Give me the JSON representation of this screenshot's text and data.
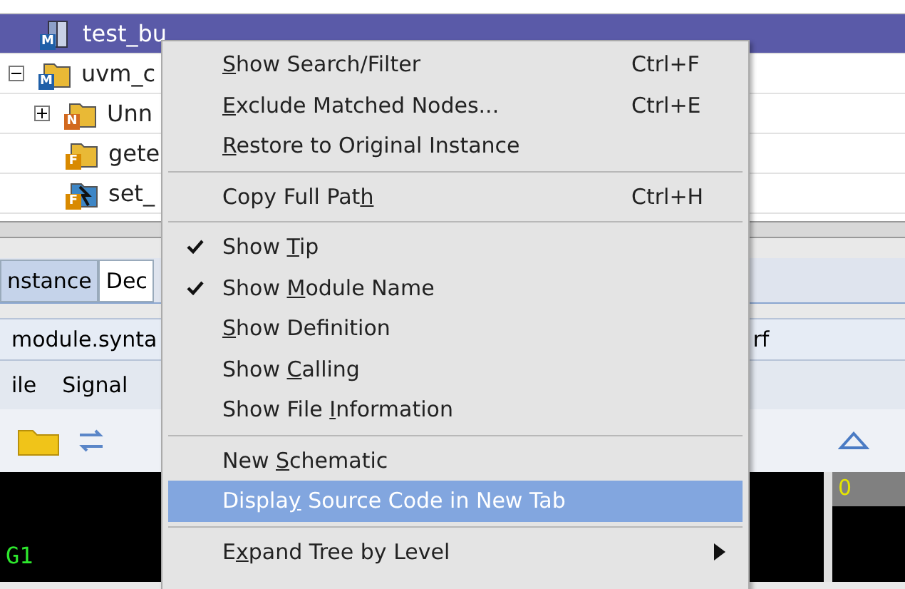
{
  "tree": [
    {
      "label": "test_bu",
      "badge": "M",
      "kind": "module",
      "selected": true
    },
    {
      "label": "uvm_c",
      "badge": "M",
      "kind": "folder",
      "selected": false,
      "expanded": true,
      "children": [
        {
          "label": "Unn",
          "badge": "N",
          "kind": "folder",
          "selected": false,
          "expanded": false
        },
        {
          "label": "gete",
          "badge": "F",
          "kind": "folder",
          "selected": false
        },
        {
          "label": "set_",
          "badge": "F",
          "kind": "function",
          "selected": false
        }
      ]
    }
  ],
  "tabs": [
    {
      "label": "nstance",
      "selected": true
    },
    {
      "label": "Dec",
      "selected": false
    }
  ],
  "path_bar": {
    "left": "module.synta",
    "right": "rf"
  },
  "menubar": [
    "ile",
    "Signal"
  ],
  "waveform": {
    "signal": "G1",
    "ruler": "0"
  },
  "context_menu": [
    [
      {
        "key": "S",
        "after": "how Search/Filter",
        "shortcut": "Ctrl+F",
        "checked": false,
        "selected": false
      },
      {
        "key": "E",
        "after": "xclude Matched Nodes...",
        "shortcut": "Ctrl+E",
        "checked": false,
        "selected": false
      },
      {
        "key": "R",
        "after": "estore to Original Instance",
        "checked": false,
        "selected": false
      }
    ],
    [
      {
        "before": "Copy Full Pat",
        "key": "h",
        "shortcut": "Ctrl+H",
        "checked": false,
        "selected": false
      }
    ],
    [
      {
        "before": "Show ",
        "key": "T",
        "after": "ip",
        "checked": true,
        "selected": false
      },
      {
        "before": "Show ",
        "key": "M",
        "after": "odule Name",
        "checked": true,
        "selected": false
      },
      {
        "key": "S",
        "after": "how Definition",
        "checked": false,
        "selected": false
      },
      {
        "before": "Show ",
        "key": "C",
        "after": "alling",
        "checked": false,
        "selected": false
      },
      {
        "before": "Show File ",
        "key": "I",
        "after": "nformation",
        "checked": false,
        "selected": false
      }
    ],
    [
      {
        "before": "New ",
        "key": "S",
        "after": "chematic",
        "checked": false,
        "selected": false
      },
      {
        "before": "Displa",
        "key": "y",
        "after": " Source Code in New Tab",
        "checked": false,
        "selected": true
      }
    ],
    [
      {
        "before": "E",
        "key": "x",
        "after": "pand Tree by Level",
        "checked": false,
        "selected": false,
        "submenu": true
      }
    ]
  ]
}
